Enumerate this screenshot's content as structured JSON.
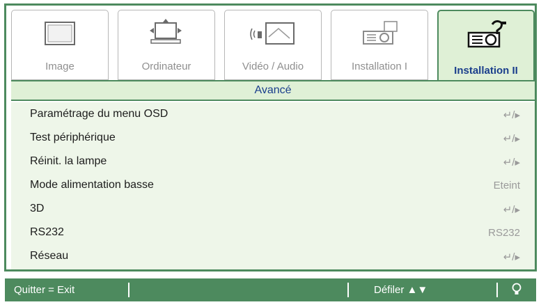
{
  "tabs": [
    {
      "label": "Image",
      "icon": "monitor-icon"
    },
    {
      "label": "Ordinateur",
      "icon": "computer-icon"
    },
    {
      "label": "Vidéo / Audio",
      "icon": "video-audio-icon"
    },
    {
      "label": "Installation I",
      "icon": "projector-icon"
    },
    {
      "label": "Installation II",
      "icon": "projector-settings-icon"
    }
  ],
  "active_tab": "Installation II",
  "section_title": "Avancé",
  "menu_items": [
    {
      "name": "Paramétrage du menu OSD",
      "value": "↵/▸"
    },
    {
      "name": "Test périphérique",
      "value": "↵/▸"
    },
    {
      "name": "Réinit. la lampe",
      "value": "↵/▸"
    },
    {
      "name": "Mode alimentation basse",
      "value": "Eteint"
    },
    {
      "name": "3D",
      "value": "↵/▸"
    },
    {
      "name": "RS232",
      "value": "RS232"
    },
    {
      "name": "Réseau",
      "value": "↵/▸"
    }
  ],
  "footer": {
    "quit": "Quitter = Exit",
    "scroll": "Défiler ▲▼",
    "icon": "bulb-icon"
  },
  "colors": {
    "accent": "#4d8a5e",
    "highlight": "#dff0d6",
    "label_active": "#1a3e8c"
  }
}
